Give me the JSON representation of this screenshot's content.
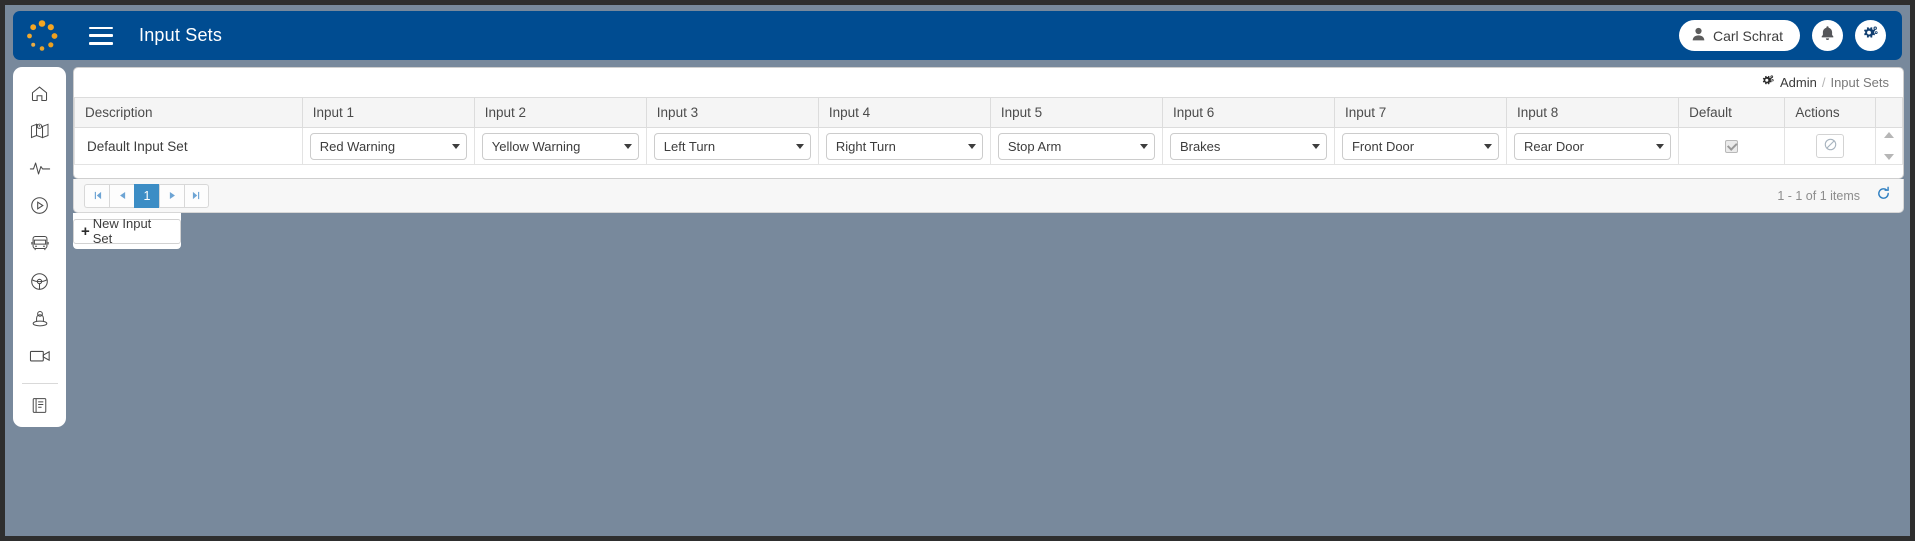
{
  "topbar": {
    "logo_icon": "spinner-logo-icon",
    "menu_icon": "hamburger-menu-icon",
    "title": "Input Sets",
    "user_name": "Carl Schrat",
    "user_icon": "user-icon",
    "notifications_icon": "bell-icon",
    "settings_icon": "gear-icon",
    "background": "#004c91"
  },
  "sidebar": {
    "items": [
      {
        "icon": "home-icon",
        "name": "sidebar-item-home"
      },
      {
        "icon": "map-icon",
        "name": "sidebar-item-map"
      },
      {
        "icon": "activity-pulse-icon",
        "name": "sidebar-item-activity"
      },
      {
        "icon": "play-circle-icon",
        "name": "sidebar-item-playback"
      },
      {
        "icon": "bus-icon",
        "name": "sidebar-item-vehicles"
      },
      {
        "icon": "steering-wheel-icon",
        "name": "sidebar-item-drivers"
      },
      {
        "icon": "person-location-icon",
        "name": "sidebar-item-students"
      },
      {
        "icon": "video-camera-icon",
        "name": "sidebar-item-video"
      },
      {
        "icon": "book-report-icon",
        "name": "sidebar-item-reports"
      }
    ]
  },
  "breadcrumb": {
    "icon": "gear-icon",
    "root": "Admin",
    "separator": "/",
    "current": "Input Sets"
  },
  "table": {
    "columns": [
      "Description",
      "Input 1",
      "Input 2",
      "Input 3",
      "Input 4",
      "Input 5",
      "Input 6",
      "Input 7",
      "Input 8",
      "Default",
      "Actions"
    ],
    "rows": [
      {
        "description": "Default Input Set",
        "input1": "Red Warning",
        "input2": "Yellow Warning",
        "input3": "Left Turn",
        "input4": "Right Turn",
        "input5": "Stop Arm",
        "input6": "Brakes",
        "input7": "Front Door",
        "input8": "Rear Door",
        "default_checked": true,
        "action_icon": "prohibited-icon"
      }
    ]
  },
  "pager": {
    "first_icon": "⏮",
    "prev_icon": "◂",
    "pages": [
      "1"
    ],
    "active_page": "1",
    "next_icon": "▸",
    "last_icon": "⏭",
    "item_count": "1 - 1 of 1 items",
    "refresh_icon": "refresh-icon",
    "active_color": "#3c8dc5"
  },
  "new_button": {
    "plus": "+",
    "label": "New Input Set"
  },
  "scrollbar": {
    "up_icon": "scroll-up-arrow-icon",
    "down_icon": "scroll-down-arrow-icon"
  }
}
